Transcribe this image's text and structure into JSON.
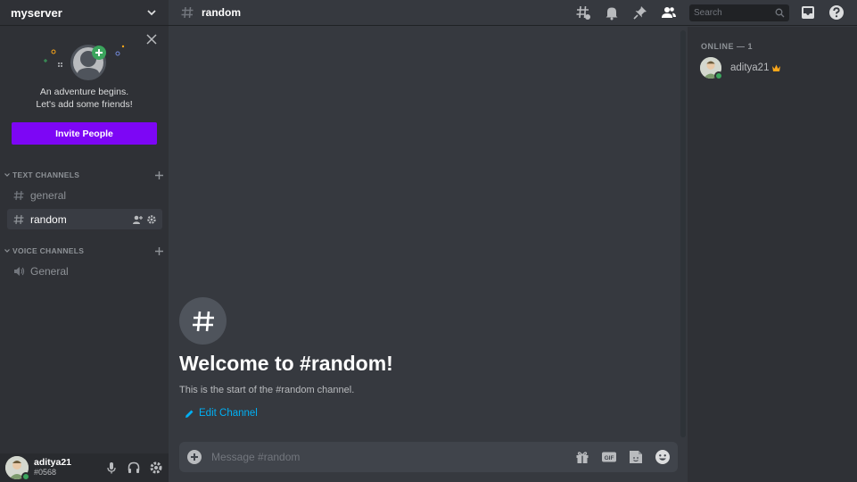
{
  "server": {
    "name": "myserver"
  },
  "invite": {
    "line1": "An adventure begins.",
    "line2": "Let's add some friends!",
    "button": "Invite People"
  },
  "categories": {
    "text": "TEXT CHANNELS",
    "voice": "VOICE CHANNELS"
  },
  "text_channels": [
    {
      "name": "general",
      "active": false
    },
    {
      "name": "random",
      "active": true
    }
  ],
  "voice_channels": [
    {
      "name": "General"
    }
  ],
  "user": {
    "name": "aditya21",
    "tag": "#0568"
  },
  "topbar": {
    "channel": "random",
    "search_placeholder": "Search"
  },
  "welcome": {
    "title": "Welcome to #random!",
    "subtitle": "This is the start of the #random channel.",
    "edit": "Edit Channel"
  },
  "composer": {
    "placeholder": "Message #random"
  },
  "members": {
    "heading": "ONLINE — 1",
    "list": [
      {
        "name": "aditya21",
        "owner": true
      }
    ]
  },
  "colors": {
    "accent": "#7d06f5",
    "link": "#00b0f4",
    "online": "#3ba55d",
    "crown": "#faa61a"
  }
}
